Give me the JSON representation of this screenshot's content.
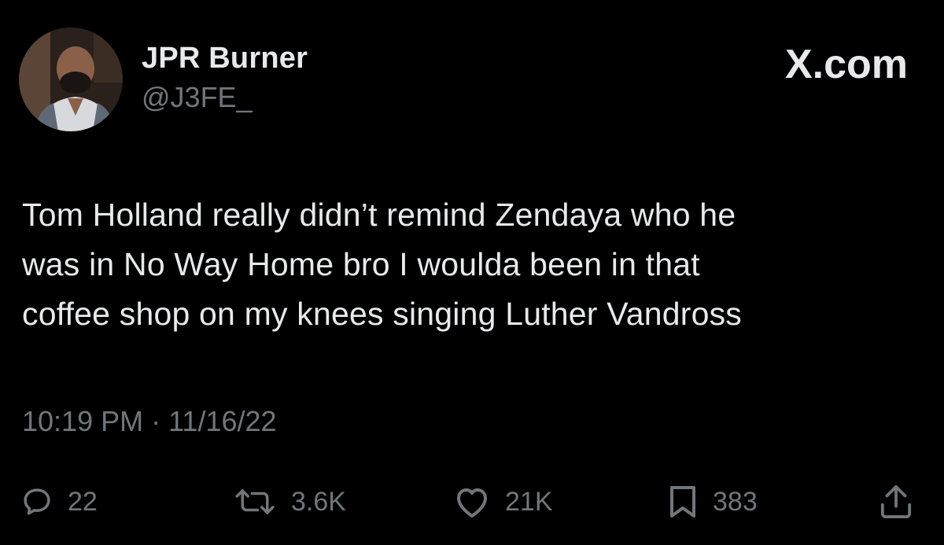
{
  "author": {
    "display_name": "JPR Burner",
    "handle": "@J3FE_"
  },
  "brand": {
    "logo_text": "X.com"
  },
  "tweet": {
    "lines": [
      "Tom Holland really didn’t remind Zendaya who he",
      "was in No Way Home bro I woulda been in that",
      "coffee shop on my knees singing Luther Vandross"
    ],
    "timestamp": "10:19 PM · 11/16/22"
  },
  "actions": {
    "replies": "22",
    "reposts": "3.6K",
    "likes": "21K",
    "bookmarks": "383",
    "icons": [
      "reply-icon",
      "repost-icon",
      "like-icon",
      "bookmark-icon",
      "share-icon"
    ]
  },
  "colors": {
    "background": "#000000",
    "text_primary": "#e7e9ea",
    "text_secondary": "#71767b"
  }
}
